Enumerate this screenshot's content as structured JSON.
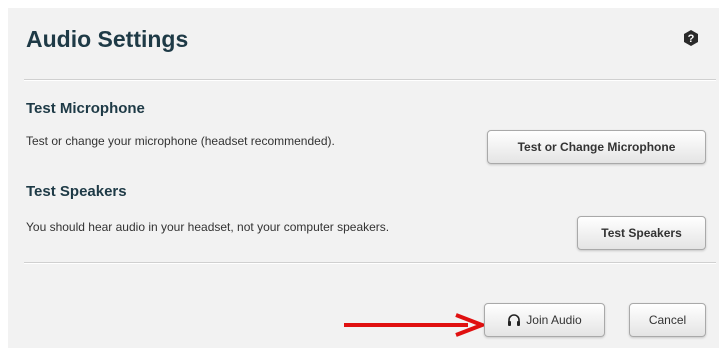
{
  "dialog": {
    "title": "Audio Settings",
    "help_icon": "question-mark-icon"
  },
  "microphone": {
    "heading": "Test Microphone",
    "description": "Test or change your microphone (headset recommended).",
    "button_label": "Test or Change Microphone"
  },
  "speakers": {
    "heading": "Test Speakers",
    "description": "You should hear audio in your headset, not your computer speakers.",
    "button_label": "Test Speakers"
  },
  "footer": {
    "join_label": "Join Audio",
    "join_icon": "headset-icon",
    "cancel_label": "Cancel"
  },
  "annotation": {
    "arrow_icon": "red-arrow-icon",
    "arrow_color": "#e01010"
  },
  "colors": {
    "heading": "#1e3a46",
    "panel_bg": "#f2f2f2"
  }
}
